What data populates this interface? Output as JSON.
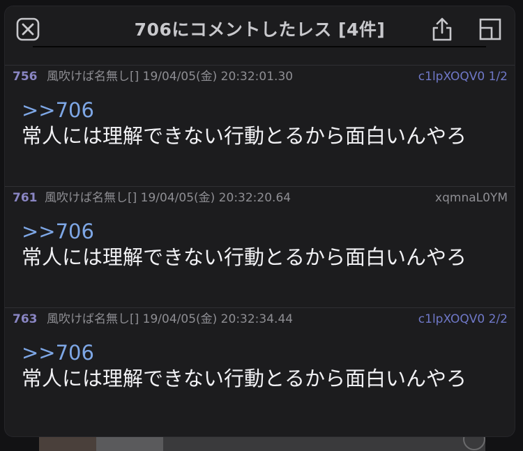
{
  "popup": {
    "title": "706にコメントしたレス [4件]",
    "icons": {
      "close": "close-icon",
      "share": "share-icon",
      "window": "window-icon"
    }
  },
  "colors": {
    "panel_bg": "#1c1c1e",
    "post_number": "#8a86c4",
    "linked_id": "#6f78c8",
    "anchor_link": "#7ea7e6",
    "meta_text": "#8e8e93",
    "body_text": "#f2f2f5"
  },
  "posts": [
    {
      "number": "756",
      "info": "風吹けば名無し[] 19/04/05(金) 20:32:01.30",
      "id": "c1lpXOQV0 1/2",
      "anchor": ">>706",
      "body": "常人には理解できない行動とるから面白いんやろ"
    },
    {
      "number": "761",
      "info": "風吹けば名無し[] 19/04/05(金) 20:32:20.64",
      "id": "xqmnaL0YM",
      "anchor": ">>706",
      "body": "常人には理解できない行動とるから面白いんやろ"
    },
    {
      "number": "763",
      "info": "風吹けば名無し[] 19/04/05(金) 20:32:34.44",
      "id": "c1lpXOQV0 2/2",
      "anchor": ">>706",
      "body": "常人には理解できない行動とるから面白いんやろ"
    }
  ]
}
